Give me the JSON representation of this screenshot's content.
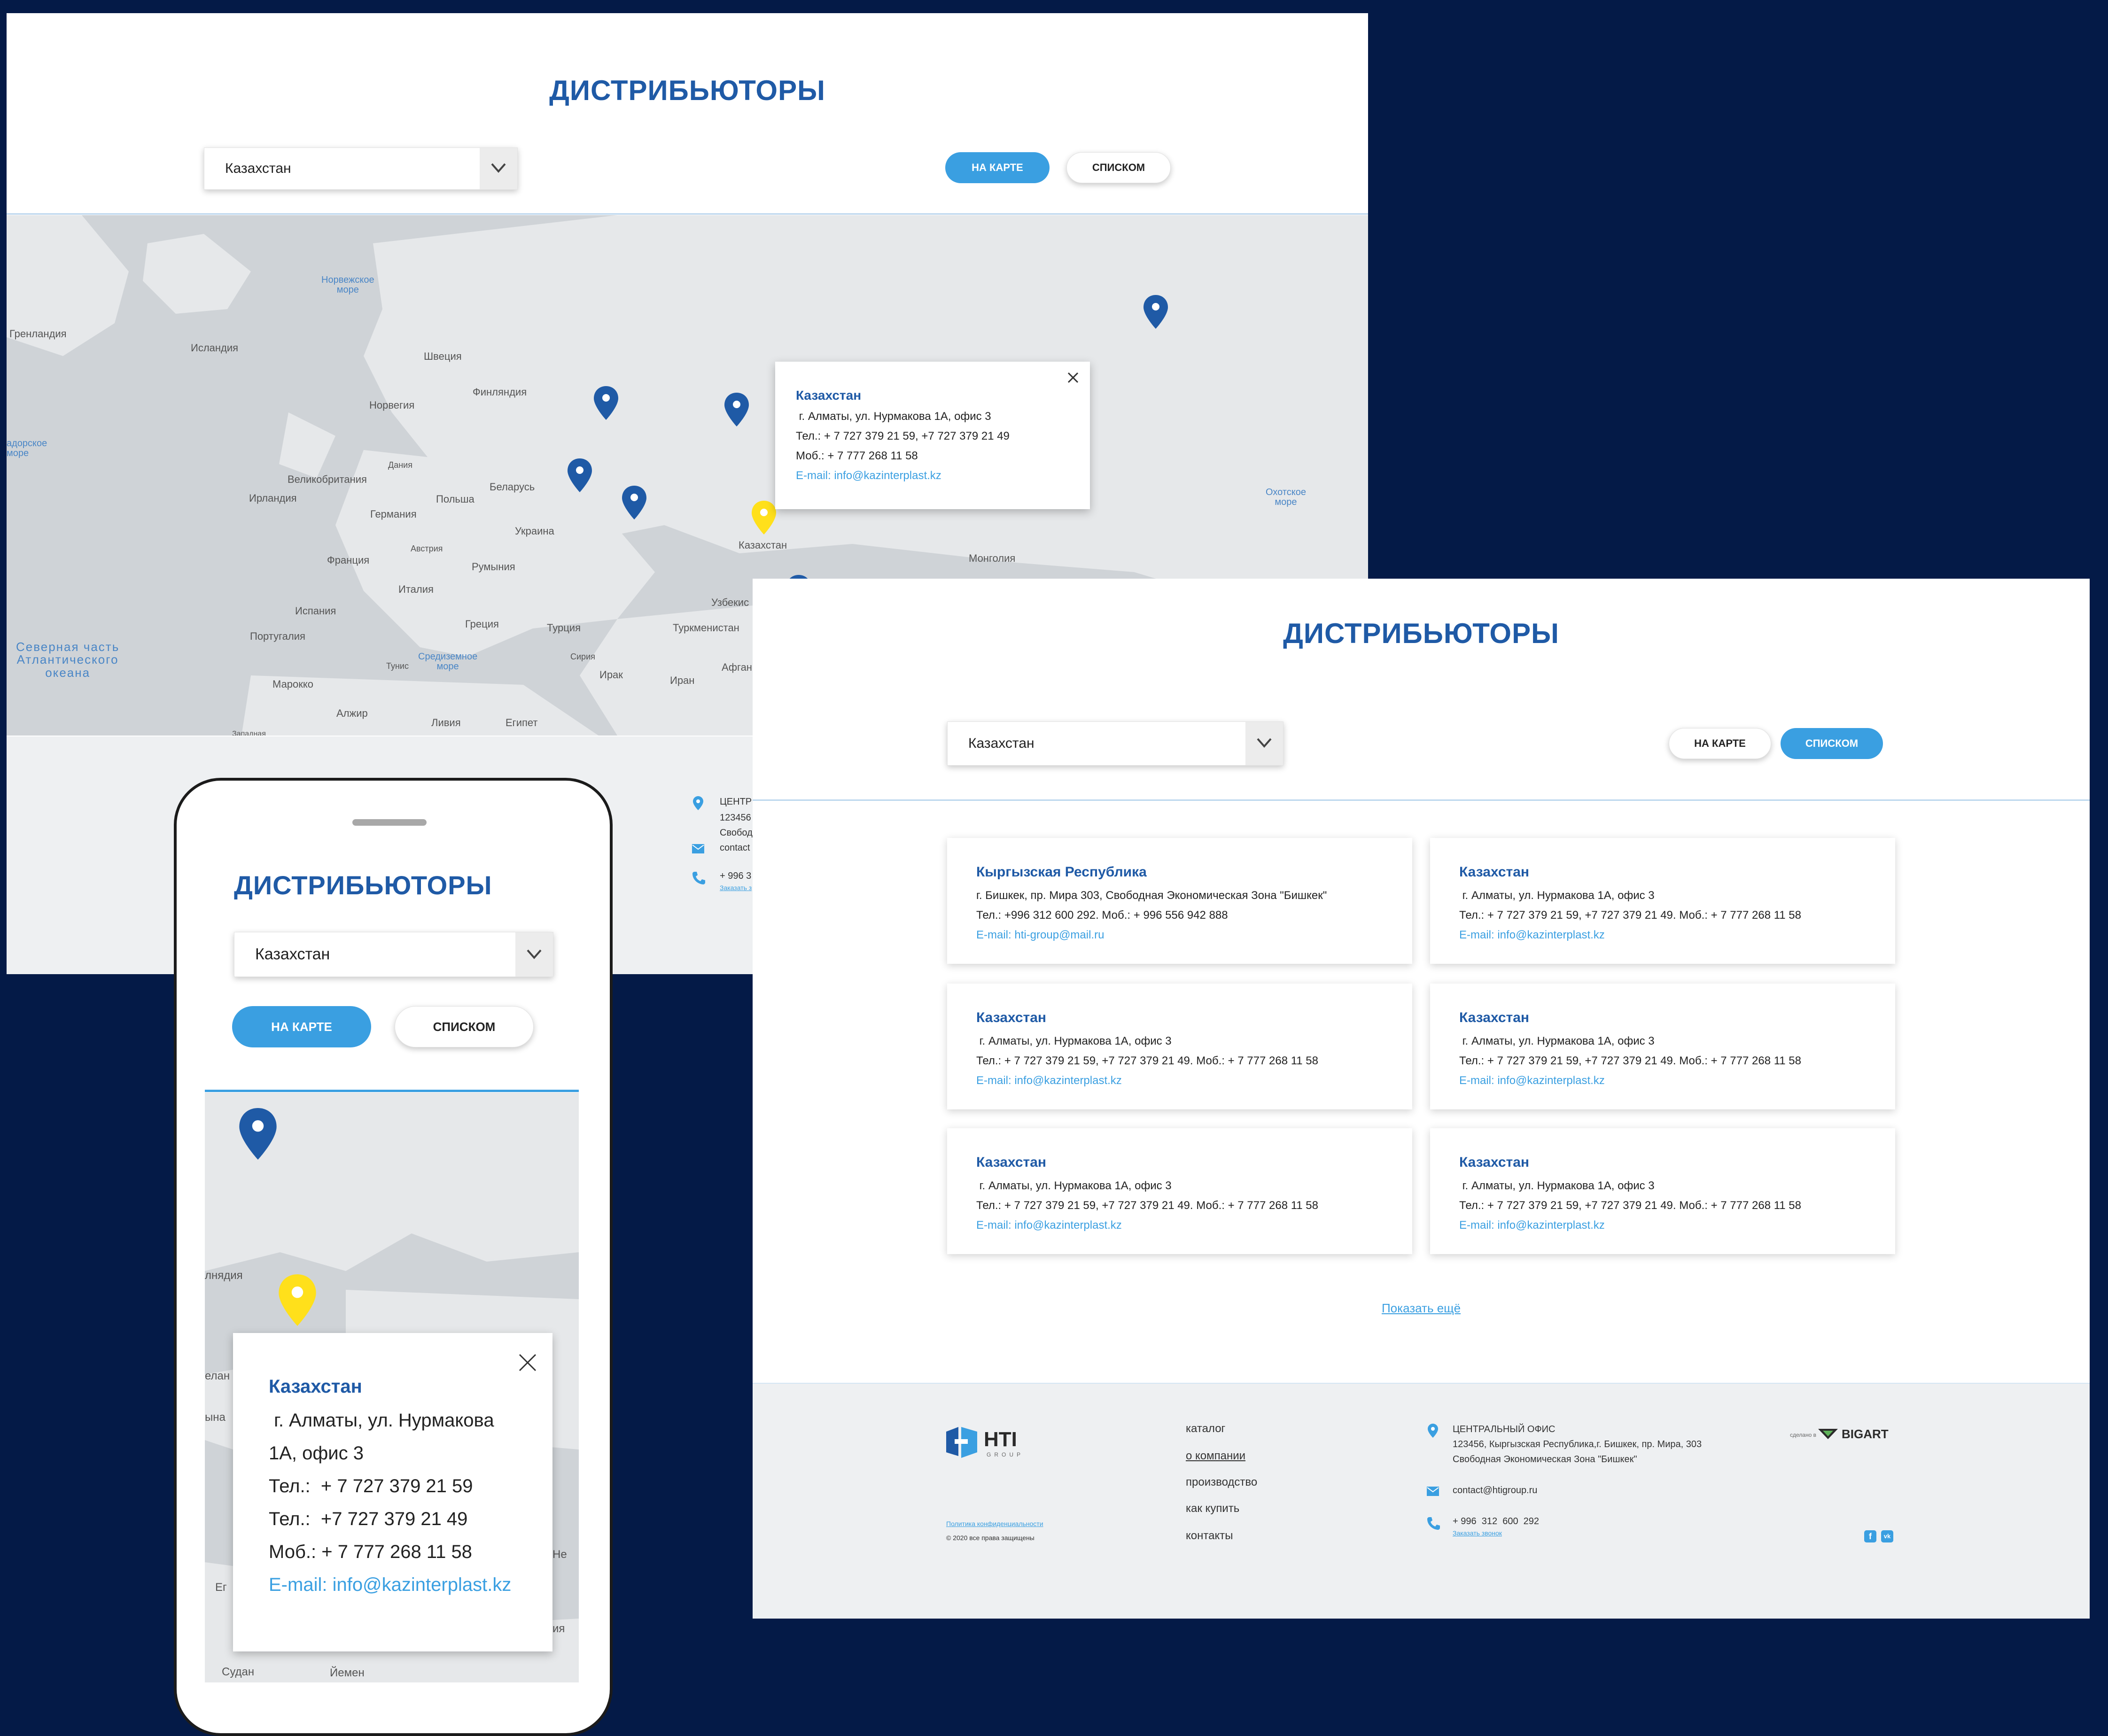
{
  "title": "ДИСТРИБЬЮТОРЫ",
  "country_select": {
    "value": "Казахстан"
  },
  "view_toggle": {
    "map": "НА КАРТЕ",
    "list": "СПИСКОМ"
  },
  "map_labels": {
    "norwegian_sea": "Норвежское\nморе",
    "greenland": "Гренландия",
    "iceland": "Исландия",
    "sweden": "Швеция",
    "finland": "Финляндия",
    "norway": "Норвегия",
    "labrador_sea": "адорское\nморе",
    "denmark": "Дания",
    "great_britain": "Великобритания",
    "ireland": "Ирландия",
    "germany": "Германия",
    "poland": "Польша",
    "belarus": "Беларусь",
    "ukraine": "Украина",
    "austria": "Австрия",
    "france": "Франция",
    "romania": "Румыния",
    "italy": "Италия",
    "spain": "Испания",
    "portugal": "Португалия",
    "greece": "Греция",
    "turkey": "Турция",
    "turkmenistan": "Туркменистан",
    "uzbekistan": "Узбекис",
    "kazakhstan": "Казахстан",
    "mongolia": "Монголия",
    "okhotsk_sea": "Охотское\nморе",
    "north_atlantic": "Северная часть\nАтлантического\nокеана",
    "mediterranean": "Средиземное\nморе",
    "tunisia": "Тунис",
    "syria": "Сирия",
    "iraq": "Ирак",
    "iran": "Иран",
    "afghanistan": "Афган",
    "morocco": "Марокко",
    "algeria": "Алжир",
    "libya": "Ливия",
    "egypt": "Египет",
    "western_sahara": "Западная"
  },
  "popup": {
    "country": "Казахстан",
    "address": " г. Алматы, ул. Нурмакова 1А, офис 3",
    "phones": "Тел.: + 7 727 379 21 59, +7 727 379 21 49",
    "mobile": "Моб.: + 7 777 268 11 58",
    "email": "E-mail: info@kazinterplast.kz"
  },
  "footer_partial": {
    "office": "ЦЕНТР",
    "address_l1": "123456",
    "address_l2": "Свобод",
    "email": "contact",
    "phone": "+ 996  3",
    "callback": "Заказать з"
  },
  "cards": [
    {
      "country": "Кыргызская Республика",
      "address": "г. Бишкек, пр. Мира 303, Свободная Экономическая Зона \"Бишкек\"",
      "phones": "Тел.: +996 312 600 292. Моб.: + 996 556 942 888",
      "email": "E-mail: hti-group@mail.ru"
    },
    {
      "country": "Казахстан",
      "address": " г. Алматы, ул. Нурмакова 1А, офис 3",
      "phones": "Тел.: + 7 727 379 21 59, +7 727 379 21 49. Моб.: + 7 777 268 11 58",
      "email": "E-mail: info@kazinterplast.kz"
    },
    {
      "country": "Казахстан",
      "address": " г. Алматы, ул. Нурмакова 1А, офис 3",
      "phones": "Тел.: + 7 727 379 21 59, +7 727 379 21 49. Моб.: + 7 777 268 11 58",
      "email": "E-mail: info@kazinterplast.kz"
    },
    {
      "country": "Казахстан",
      "address": " г. Алматы, ул. Нурмакова 1А, офис 3",
      "phones": "Тел.: + 7 727 379 21 59, +7 727 379 21 49. Моб.: + 7 777 268 11 58",
      "email": "E-mail: info@kazinterplast.kz"
    },
    {
      "country": "Казахстан",
      "address": " г. Алматы, ул. Нурмакова 1А, офис 3",
      "phones": "Тел.: + 7 727 379 21 59, +7 727 379 21 49. Моб.: + 7 777 268 11 58",
      "email": "E-mail: info@kazinterplast.kz"
    },
    {
      "country": "Казахстан",
      "address": " г. Алматы, ул. Нурмакова 1А, офис 3",
      "phones": "Тел.: + 7 727 379 21 59, +7 727 379 21 49. Моб.: + 7 777 268 11 58",
      "email": "E-mail: info@kazinterplast.kz"
    }
  ],
  "show_more": "Показать ещё",
  "footer": {
    "logo": {
      "text": "HTI",
      "sub": "GROUP"
    },
    "privacy": "Политика конфиденциальности",
    "copyright": "© 2020 все права защищены",
    "nav": [
      "каталог",
      "о компании",
      "производство",
      "как купить",
      "контакты"
    ],
    "office_title": "ЦЕНТРАЛЬНЫЙ ОФИС",
    "office_address_l1": "123456, Кыргызская Республика,г. Бишкек, пр. Мира, 303",
    "office_address_l2": "Свободная Экономическая Зона \"Бишкек\"",
    "email": "contact@htigroup.ru",
    "phone": "+ 996  312  600  292",
    "callback": "Заказать звонок",
    "dev_label": "сделано в",
    "dev_brand": "BIGART",
    "social": [
      "f",
      "vk"
    ]
  },
  "mobile": {
    "title": "ДИСТРИБЬЮТОРЫ",
    "select_value": "Казахстан",
    "btn_map": "НА КАРТЕ",
    "btn_list": "СПИСКОМ",
    "map_labels": {
      "greenland": "лнядия",
      "iceland": "елан",
      "europe": "ына",
      "spain": "Ег",
      "he": "Не",
      "ya": "ия",
      "sudan": "Судан",
      "yemen": "Йемен"
    },
    "popup": {
      "country": "Казахстан",
      "address_l1": " г. Алматы, ул. Нурмакова",
      "address_l2": "1А, офис 3",
      "phone1": "Тел.:  + 7 727 379 21 59",
      "phone2": "Тел.:  +7 727 379 21 49",
      "mobile": "Моб.: + 7 777 268 11 58",
      "email": "E-mail: info@kazinterplast.kz"
    }
  }
}
